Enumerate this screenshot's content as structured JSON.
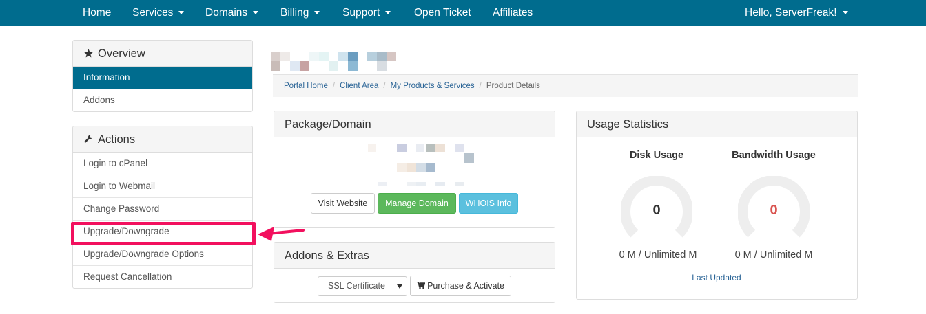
{
  "nav": {
    "items": [
      {
        "label": "Home",
        "dropdown": false
      },
      {
        "label": "Services",
        "dropdown": true
      },
      {
        "label": "Domains",
        "dropdown": true
      },
      {
        "label": "Billing",
        "dropdown": true
      },
      {
        "label": "Support",
        "dropdown": true
      },
      {
        "label": "Open Ticket",
        "dropdown": false
      },
      {
        "label": "Affiliates",
        "dropdown": false
      }
    ],
    "user": "Hello, ServerFreak!"
  },
  "sidebar": {
    "overview": {
      "title": "Overview",
      "icon": "star-icon",
      "items": [
        "Information",
        "Addons"
      ],
      "active": "Information"
    },
    "actions": {
      "title": "Actions",
      "icon": "wrench-icon",
      "items": [
        "Login to cPanel",
        "Login to Webmail",
        "Change Password",
        "Upgrade/Downgrade",
        "Upgrade/Downgrade Options",
        "Request Cancellation"
      ]
    }
  },
  "breadcrumb": [
    "Portal Home",
    "Client Area",
    "My Products & Services",
    "Product Details"
  ],
  "package": {
    "title": "Package/Domain",
    "buttons": {
      "visit": "Visit Website",
      "manage": "Manage Domain",
      "whois": "WHOIS Info"
    }
  },
  "addons": {
    "title": "Addons & Extras",
    "select_value": "SSL Certificate",
    "purchase": "Purchase & Activate"
  },
  "usage": {
    "title": "Usage Statistics",
    "disk": {
      "title": "Disk Usage",
      "value": "0",
      "text": "0 M / Unlimited M"
    },
    "bandwidth": {
      "title": "Bandwidth Usage",
      "value": "0",
      "text": "0 M / Unlimited M"
    },
    "last_updated": "Last Updated"
  },
  "colors": {
    "nav_bg": "#006c8e",
    "highlight": "#f2105e",
    "bandwidth_value": "#d9534f",
    "success": "#5cb85c",
    "info": "#5bc0de"
  }
}
